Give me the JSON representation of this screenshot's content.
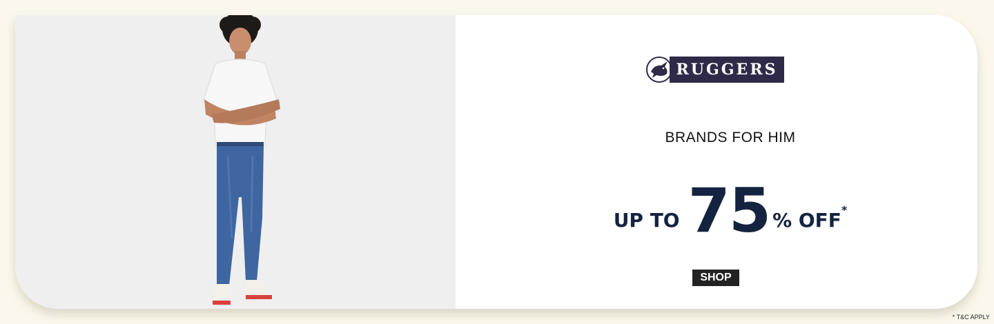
{
  "banner": {
    "brand": {
      "name": "RUGGERS",
      "emblem_icon": "marlin-fish-icon",
      "plate_color": "#2e2a47"
    },
    "model_image": "man-in-white-tee-and-blue-jeans",
    "tagline": "BRANDS FOR HIM",
    "offer": {
      "prefix": "UP TO",
      "value": "75",
      "suffix": "% OFF",
      "asterisk": "*",
      "color": "#14233f"
    },
    "cta": {
      "label": "SHOP"
    },
    "terms": "* T&C APPLY"
  }
}
